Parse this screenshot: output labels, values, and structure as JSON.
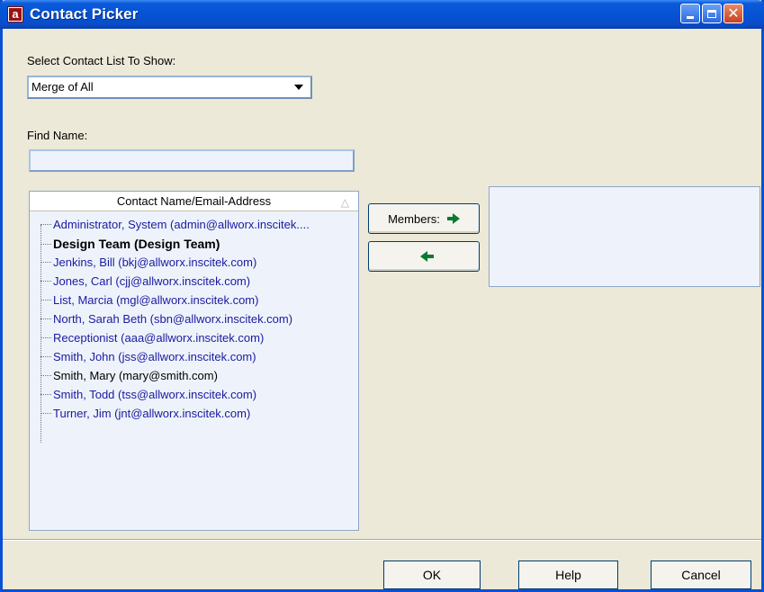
{
  "window": {
    "title": "Contact Picker",
    "app_icon_letter": "a"
  },
  "form": {
    "select_label": "Select Contact List To Show:",
    "select_value": "Merge of All",
    "find_label": "Find Name:",
    "find_value": ""
  },
  "contacts": {
    "header": "Contact Name/Email-Address",
    "items": [
      {
        "label": "Administrator, System (admin@allworx.inscitek....",
        "style": "link"
      },
      {
        "label": "Design Team (Design Team)",
        "style": "bold"
      },
      {
        "label": "Jenkins, Bill (bkj@allworx.inscitek.com)",
        "style": "link"
      },
      {
        "label": "Jones, Carl (cjj@allworx.inscitek.com)",
        "style": "link"
      },
      {
        "label": "List, Marcia (mgl@allworx.inscitek.com)",
        "style": "link"
      },
      {
        "label": "North, Sarah Beth (sbn@allworx.inscitek.com)",
        "style": "link"
      },
      {
        "label": "Receptionist (aaa@allworx.inscitek.com)",
        "style": "link"
      },
      {
        "label": "Smith, John (jss@allworx.inscitek.com)",
        "style": "link"
      },
      {
        "label": "Smith, Mary (mary@smith.com)",
        "style": "dark"
      },
      {
        "label": "Smith, Todd (tss@allworx.inscitek.com)",
        "style": "link"
      },
      {
        "label": "Turner, Jim (jnt@allworx.inscitek.com)",
        "style": "link"
      }
    ]
  },
  "buttons": {
    "members": "Members:",
    "ok": "OK",
    "help": "Help",
    "cancel": "Cancel"
  },
  "colors": {
    "titlebar": "#0553d4",
    "link_text": "#1a1aa0",
    "arrow": "#0a7a33"
  },
  "icons": {
    "add_member": "arrow-right-icon",
    "remove_member": "arrow-left-icon",
    "dropdown": "chevron-down-icon"
  }
}
